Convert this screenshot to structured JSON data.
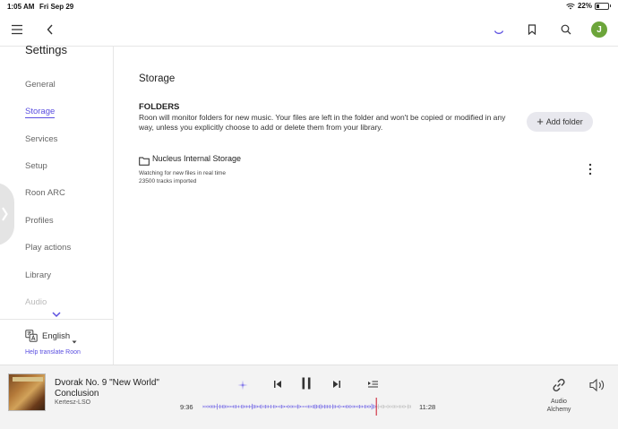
{
  "status_bar": {
    "time": "1:05 AM",
    "date": "Fri Sep 29",
    "battery": "22%"
  },
  "header": {
    "avatar_initial": "J",
    "icons": [
      "menu-icon",
      "back-icon",
      "loading-spinner-icon",
      "bookmark-icon",
      "search-icon"
    ]
  },
  "sidebar": {
    "title": "Settings",
    "items": [
      {
        "label": "General",
        "active": false
      },
      {
        "label": "Storage",
        "active": true
      },
      {
        "label": "Services",
        "active": false
      },
      {
        "label": "Setup",
        "active": false
      },
      {
        "label": "Roon ARC",
        "active": false
      },
      {
        "label": "Profiles",
        "active": false
      },
      {
        "label": "Play actions",
        "active": false
      },
      {
        "label": "Library",
        "active": false
      },
      {
        "label": "Audio",
        "active": false
      }
    ],
    "language": "English",
    "translate_link": "Help translate Roon"
  },
  "main": {
    "page_title": "Storage",
    "folders_heading": "FOLDERS",
    "folders_description": "Roon will monitor folders for new music. Your files are left in the folder and won't be copied or modified in any way, unless you explicitly choose to add or delete them from your library.",
    "add_folder_label": "Add folder",
    "storage_item": {
      "name": "Nucleus Internal Storage",
      "status": "Watching for new files in real time",
      "count": "23500 tracks imported"
    }
  },
  "player": {
    "track_title": "Dvorak No. 9 \"New World\"",
    "track_movement": "Conclusion",
    "artist": "Kertesz-LSO",
    "elapsed": "9:36",
    "total": "11:28",
    "progress": 0.83,
    "zone_name": "Audio Alchemy"
  },
  "colors": {
    "accent": "#5a4ee0",
    "avatar": "#6ca53a",
    "playhead": "#d2384a"
  }
}
